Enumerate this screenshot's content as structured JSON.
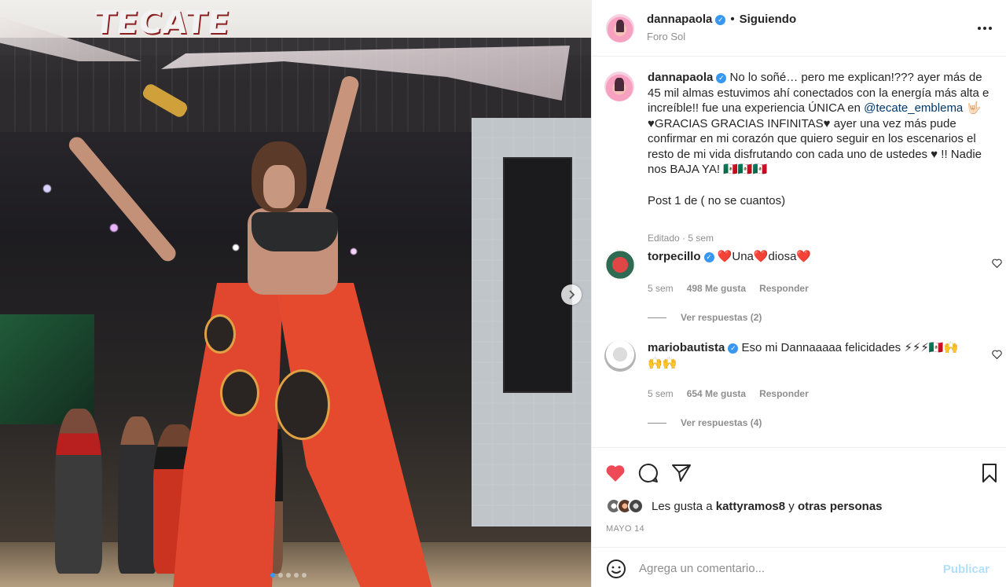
{
  "post": {
    "image_brand": "TECATE",
    "carousel_dots": 5,
    "carousel_active": 0
  },
  "header": {
    "username": "dannapaola",
    "separator": "•",
    "follow_status": "Siguiendo",
    "location": "Foro Sol"
  },
  "caption": {
    "username": "dannapaola",
    "text_1": "No lo soñé… pero me explican!??? ayer más de 45 mil almas estuvimos ahí conectados con la energía más alta e increíble!! fue una experiencia ÚNICA en ",
    "mention": "@tecate_emblema",
    "text_2": " 🤟🏻 ♥GRACIAS GRACIAS INFINITAS♥ ayer una vez más pude confirmar en mi corazón que quiero seguir en los escenarios el resto de mi vida disfrutando con cada uno de ustedes ♥ !! Nadie nos BAJA YA! 🇲🇽🇲🇽🇲🇽",
    "extra": "Post 1 de ( no se cuantos)",
    "meta": "Editado · 5 sem"
  },
  "comments": [
    {
      "username": "torpecillo",
      "text": "❤️Una❤️diosa❤️",
      "time": "5 sem",
      "likes": "498 Me gusta",
      "reply": "Responder",
      "view_replies": "Ver respuestas (2)"
    },
    {
      "username": "mariobautista",
      "text": "Eso mi Dannaaaaa felicidades ⚡⚡⚡🇲🇽🙌🙌🙌",
      "time": "5 sem",
      "likes": "654 Me gusta",
      "reply": "Responder",
      "view_replies": "Ver respuestas (4)"
    }
  ],
  "likes": {
    "prefix": "Les gusta a ",
    "user": "kattyramos8",
    "middle": " y ",
    "others": "otras personas"
  },
  "date": "MAYO 14",
  "add_comment": {
    "placeholder": "Agrega un comentario...",
    "publish": "Publicar"
  },
  "colors": {
    "like_red": "#ed4956",
    "link_blue": "#00376b",
    "verified_blue": "#3897f0",
    "publish_disabled": "#b2dffc"
  },
  "icons": [
    "more-options-icon",
    "verified-icon",
    "heart-icon",
    "comment-icon",
    "share-icon",
    "bookmark-icon",
    "emoji-icon",
    "chevron-right-icon"
  ]
}
